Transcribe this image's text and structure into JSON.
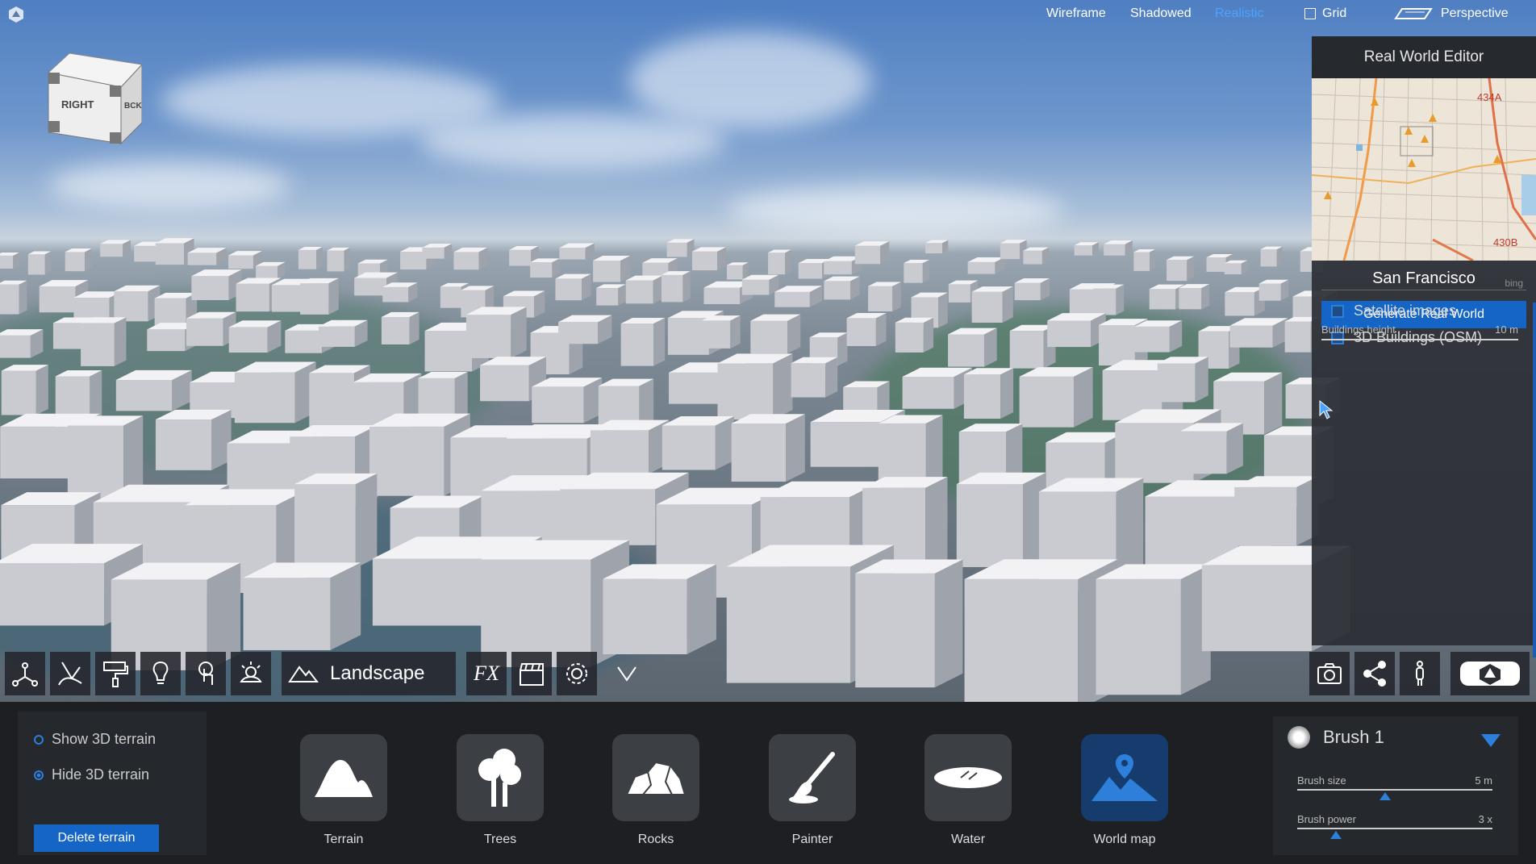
{
  "topbar": {
    "view_modes": [
      "Wireframe",
      "Shadowed",
      "Realistic"
    ],
    "active_mode": "Realistic",
    "grid_label": "Grid",
    "camera_label": "Perspective"
  },
  "navcube": {
    "front": "RIGHT",
    "side": "BCK"
  },
  "real_world_editor": {
    "title": "Real World Editor",
    "map_labels": [
      "434A",
      "430B"
    ],
    "city": "San Francisco",
    "provider": "bing",
    "generate_label": "Generate Real World",
    "satellite_label": "Satellite images",
    "buildings_label": "3D Buildings (OSM)",
    "buildings_height_label": "Buildings height",
    "buildings_height_value": "10 m"
  },
  "toolbar": {
    "tools_left": [
      "nodes-icon",
      "brush-path-icon",
      "paint-roller-icon",
      "light-bulb-icon",
      "touch-icon",
      "weather-icon"
    ],
    "section_label": "Landscape",
    "tools_mid": [
      "fx-icon",
      "clapper-icon",
      "settings-gear-icon",
      "chevron-down-icon"
    ],
    "tools_right": [
      "camera-icon",
      "share-icon",
      "person-icon",
      "logo-icon"
    ],
    "fx_text": "FX"
  },
  "terrain_options": {
    "show_label": "Show 3D terrain",
    "hide_label": "Hide 3D terrain",
    "selected": "Hide 3D terrain",
    "delete_label": "Delete terrain"
  },
  "tools": [
    {
      "label": "Terrain",
      "icon": "mountain-icon"
    },
    {
      "label": "Trees",
      "icon": "tree-icon"
    },
    {
      "label": "Rocks",
      "icon": "rocks-icon"
    },
    {
      "label": "Painter",
      "icon": "paintbrush-icon"
    },
    {
      "label": "Water",
      "icon": "water-icon"
    },
    {
      "label": "World map",
      "icon": "world-map-pin-icon"
    }
  ],
  "active_tool": "World map",
  "brush": {
    "name": "Brush 1",
    "size_label": "Brush size",
    "size_value": "5 m",
    "size_level": 0.45,
    "power_label": "Brush power",
    "power_value": "3 x",
    "power_level": 0.2
  },
  "colors": {
    "accent": "#1465c5",
    "active_text": "#4aa3ff"
  }
}
